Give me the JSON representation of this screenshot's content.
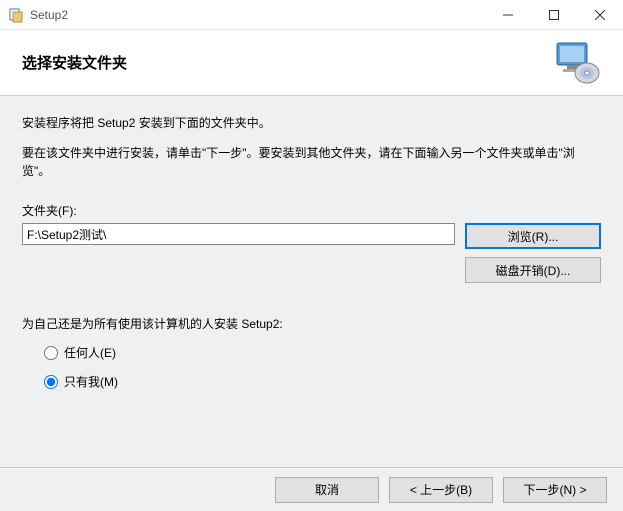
{
  "titlebar": {
    "title": "Setup2"
  },
  "header": {
    "title": "选择安装文件夹"
  },
  "body": {
    "line1": "安装程序将把 Setup2 安装到下面的文件夹中。",
    "line2": "要在该文件夹中进行安装，请单击\"下一步\"。要安装到其他文件夹，请在下面输入另一个文件夹或单击\"浏览\"。",
    "folder_label": "文件夹(F):",
    "folder_value": "F:\\Setup2测试\\",
    "browse": "浏览(R)...",
    "disk_cost": "磁盘开销(D)...",
    "install_for_label": "为自己还是为所有使用该计算机的人安装 Setup2:",
    "radio_everyone": "任何人(E)",
    "radio_just_me": "只有我(M)"
  },
  "footer": {
    "cancel": "取消",
    "back": "< 上一步(B)",
    "next": "下一步(N) >"
  }
}
